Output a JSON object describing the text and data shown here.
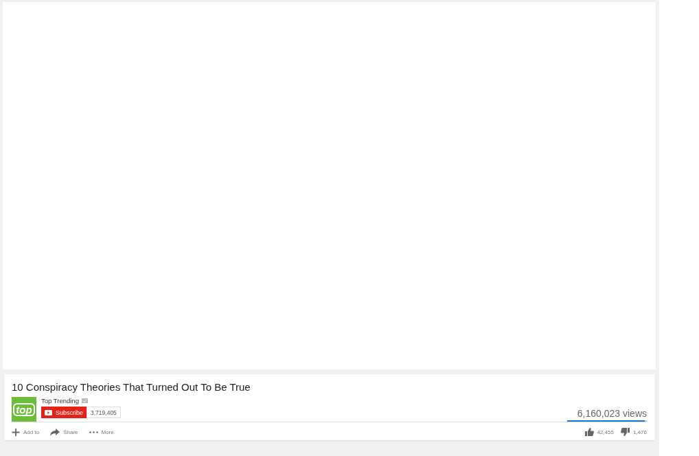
{
  "video": {
    "title": "10 Conspiracy Theories That Turned Out To Be True"
  },
  "channel": {
    "logo_text": "top",
    "name": "Top Trending",
    "verified": true,
    "subscribe_label": "Subscribe",
    "subscriber_count": "3,719,405"
  },
  "views": "6,160,023 views",
  "rating": {
    "level": 0.97,
    "likes": "42,455",
    "dislikes": "1,476"
  },
  "actions": [
    {
      "kind": "add",
      "label": "Add to"
    },
    {
      "kind": "share",
      "label": "Share"
    },
    {
      "kind": "more",
      "label": "More"
    }
  ]
}
